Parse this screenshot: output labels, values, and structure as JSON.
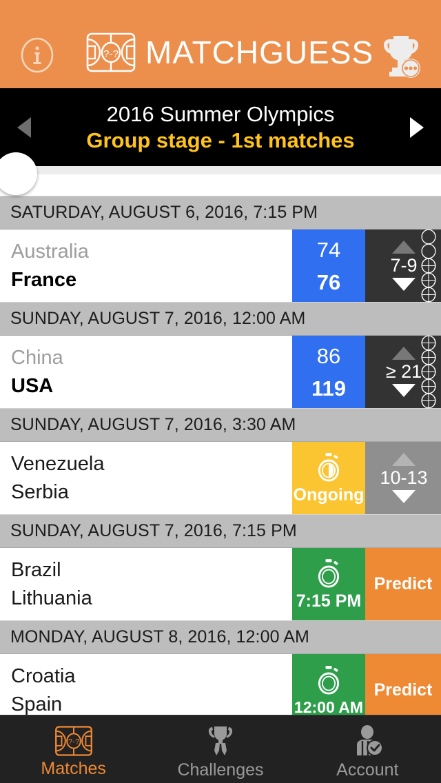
{
  "app": {
    "title": "MATCHGUESS",
    "brand_color": "#EC8F4D",
    "info_icon": "info-circle-icon",
    "logo_icon": "basketball-court-question-icon",
    "trophy_icon": "trophy-icon"
  },
  "tournament": {
    "name": "2016 Summer Olympics",
    "round": "Group stage - 1st matches",
    "prev_icon": "triangle-left-icon",
    "next_icon": "triangle-right-icon",
    "round_color": "#FFC31F"
  },
  "matches": [
    {
      "date": "SATURDAY, AUGUST 6, 2016, 7:15 PM",
      "team_a": "Australia",
      "team_b": "France",
      "team_a_state": "loser",
      "team_b_state": "winner",
      "status": "final",
      "score_a": "74",
      "score_b": "76",
      "status_label": "",
      "prediction_state": "done",
      "prediction_range": "7-9",
      "up_icon": "triangle-up-icon",
      "down_icon": "triangle-down-icon",
      "balls_total": 5,
      "balls_filled": 3,
      "score_color": "#2F6FF0"
    },
    {
      "date": "SUNDAY, AUGUST 7, 2016, 12:00 AM",
      "team_a": "China",
      "team_b": "USA",
      "team_a_state": "loser",
      "team_b_state": "winner",
      "status": "final",
      "score_a": "86",
      "score_b": "119",
      "status_label": "",
      "prediction_state": "done",
      "prediction_range": "≥ 21",
      "up_icon": "triangle-up-icon",
      "down_icon": "triangle-down-icon",
      "balls_total": 5,
      "balls_filled": 5,
      "score_color": "#2F6FF0"
    },
    {
      "date": "SUNDAY, AUGUST 7, 2016, 3:30 AM",
      "team_a": "Venezuela",
      "team_b": "Serbia",
      "team_a_state": "plain",
      "team_b_state": "plain",
      "status": "ongoing",
      "score_a": "",
      "score_b": "",
      "status_label": "Ongoing",
      "status_icon": "stopwatch-half-icon",
      "prediction_state": "pending",
      "prediction_range": "10-13",
      "up_icon": "triangle-up-icon",
      "down_icon": "triangle-down-icon",
      "balls_total": 0,
      "balls_filled": 0,
      "score_color": "#FBC431"
    },
    {
      "date": "SUNDAY, AUGUST 7, 2016, 7:15 PM",
      "team_a": "Brazil",
      "team_b": "Lithuania",
      "team_a_state": "plain",
      "team_b_state": "plain",
      "status": "upcoming",
      "score_a": "",
      "score_b": "",
      "status_label": "7:15 PM",
      "status_icon": "stopwatch-icon",
      "prediction_state": "cta",
      "predict_label": "Predict",
      "score_color": "#2E9E4B"
    },
    {
      "date": "MONDAY, AUGUST 8, 2016, 12:00 AM",
      "team_a": "Croatia",
      "team_b": "Spain",
      "team_a_state": "plain",
      "team_b_state": "plain",
      "status": "upcoming",
      "score_a": "",
      "score_b": "",
      "status_label": "12:00 AM",
      "status_icon": "stopwatch-icon",
      "prediction_state": "cta",
      "predict_label": "Predict",
      "score_color": "#2E9E4B"
    }
  ],
  "tabs": [
    {
      "label": "Matches",
      "icon": "basketball-court-question-icon",
      "active": true
    },
    {
      "label": "Challenges",
      "icon": "trophy-medal-icon",
      "active": false
    },
    {
      "label": "Account",
      "icon": "user-badge-check-icon",
      "active": false
    }
  ]
}
